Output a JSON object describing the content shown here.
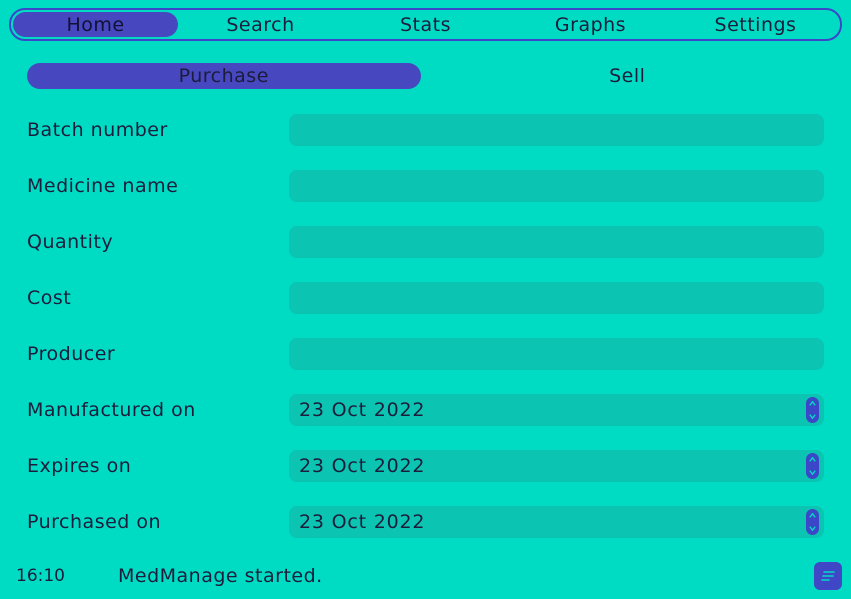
{
  "nav": {
    "tabs": [
      {
        "label": "Home",
        "active": true
      },
      {
        "label": "Search",
        "active": false
      },
      {
        "label": "Stats",
        "active": false
      },
      {
        "label": "Graphs",
        "active": false
      },
      {
        "label": "Settings",
        "active": false
      }
    ]
  },
  "subtabs": {
    "purchase": "Purchase",
    "sell": "Sell"
  },
  "form": {
    "batch_number": {
      "label": "Batch number",
      "value": ""
    },
    "medicine_name": {
      "label": "Medicine name",
      "value": ""
    },
    "quantity": {
      "label": "Quantity",
      "value": ""
    },
    "cost": {
      "label": "Cost",
      "value": ""
    },
    "producer": {
      "label": "Producer",
      "value": ""
    },
    "manufactured_on": {
      "label": "Manufactured on",
      "value": "23 Oct 2022"
    },
    "expires_on": {
      "label": "Expires on",
      "value": "23 Oct 2022"
    },
    "purchased_on": {
      "label": "Purchased on",
      "value": "23 Oct 2022"
    }
  },
  "status": {
    "time": "16:10",
    "message": "MedManage started."
  },
  "colors": {
    "background": "#00dcc4",
    "accent": "#4747c0",
    "field": "#0bc4b1"
  },
  "icons": {
    "log": "log-list-icon",
    "spin_up": "chevron-up-icon",
    "spin_down": "chevron-down-icon"
  }
}
